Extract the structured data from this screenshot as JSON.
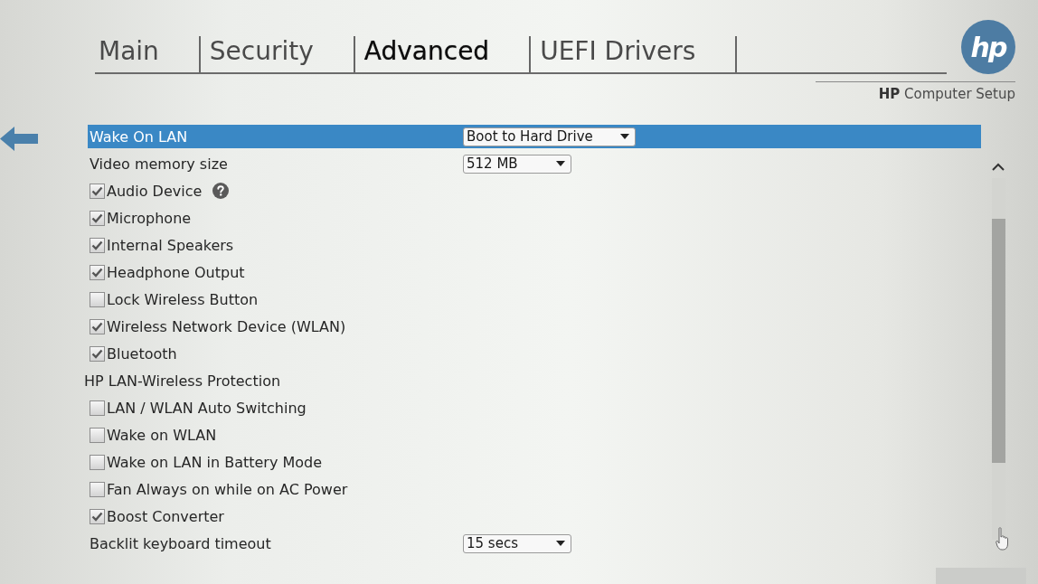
{
  "tabs": [
    {
      "label": "Main",
      "selected": false
    },
    {
      "label": "Security",
      "selected": false
    },
    {
      "label": "Advanced",
      "selected": true
    },
    {
      "label": "UEFI Drivers",
      "selected": false
    }
  ],
  "brand": {
    "logo": "hp",
    "title": "**HP** Computer Setup"
  },
  "settings": [
    {
      "kind": "dropdown",
      "label": "Wake On LAN",
      "value": "Boot to Hard Drive",
      "selected": true
    },
    {
      "kind": "dropdown",
      "label": "Video memory size",
      "value": "512 MB",
      "selected": false
    },
    {
      "kind": "checkbox",
      "label": "Audio Device",
      "checked": true,
      "help": true,
      "selected": false
    },
    {
      "kind": "checkbox",
      "label": "Microphone",
      "checked": true,
      "selected": false
    },
    {
      "kind": "checkbox",
      "label": "Internal Speakers",
      "checked": true,
      "selected": false
    },
    {
      "kind": "checkbox",
      "label": "Headphone Output",
      "checked": true,
      "selected": false
    },
    {
      "kind": "checkbox",
      "label": "Lock Wireless Button",
      "checked": false,
      "selected": false
    },
    {
      "kind": "checkbox",
      "label": "Wireless Network Device (WLAN)",
      "checked": true,
      "selected": false
    },
    {
      "kind": "checkbox",
      "label": "Bluetooth",
      "checked": true,
      "selected": false
    },
    {
      "kind": "heading",
      "label": "HP LAN-Wireless Protection",
      "selected": false
    },
    {
      "kind": "checkbox",
      "label": "LAN / WLAN Auto Switching",
      "checked": false,
      "selected": false
    },
    {
      "kind": "checkbox",
      "label": "Wake on WLAN",
      "checked": false,
      "selected": false
    },
    {
      "kind": "checkbox",
      "label": "Wake on LAN in Battery Mode",
      "checked": false,
      "selected": false
    },
    {
      "kind": "checkbox",
      "label": "Fan Always on while on AC Power",
      "checked": false,
      "selected": false
    },
    {
      "kind": "checkbox",
      "label": "Boost Converter",
      "checked": true,
      "selected": false
    },
    {
      "kind": "dropdown",
      "label": "Backlit keyboard timeout",
      "value": "15 secs",
      "selected": false
    }
  ]
}
